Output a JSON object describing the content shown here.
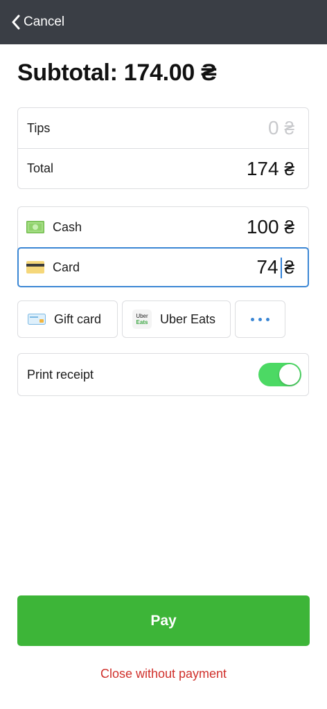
{
  "header": {
    "cancel_label": "Cancel",
    "background": "#3a3e45"
  },
  "subtotal": {
    "text": "Subtotal: 174.00 ₴"
  },
  "summary": {
    "tips_label": "Tips",
    "tips_value": "0",
    "total_label": "Total",
    "total_value": "174",
    "currency": "₴"
  },
  "payments": {
    "cash_label": "Cash",
    "cash_value": "100",
    "card_label": "Card",
    "card_value": "74",
    "currency": "₴",
    "active_border": "#3a86d4"
  },
  "methods": {
    "gift_card_label": "Gift card",
    "uber_eats_label": "Uber Eats",
    "uber_logo_top": "Uber",
    "uber_logo_bottom": "Eats",
    "more_icon": "ellipsis-icon"
  },
  "receipt": {
    "label": "Print receipt",
    "enabled": true,
    "toggle_color": "#4cd964"
  },
  "actions": {
    "pay_label": "Pay",
    "pay_color": "#3db538",
    "close_label": "Close without payment",
    "close_color": "#d0302b"
  }
}
